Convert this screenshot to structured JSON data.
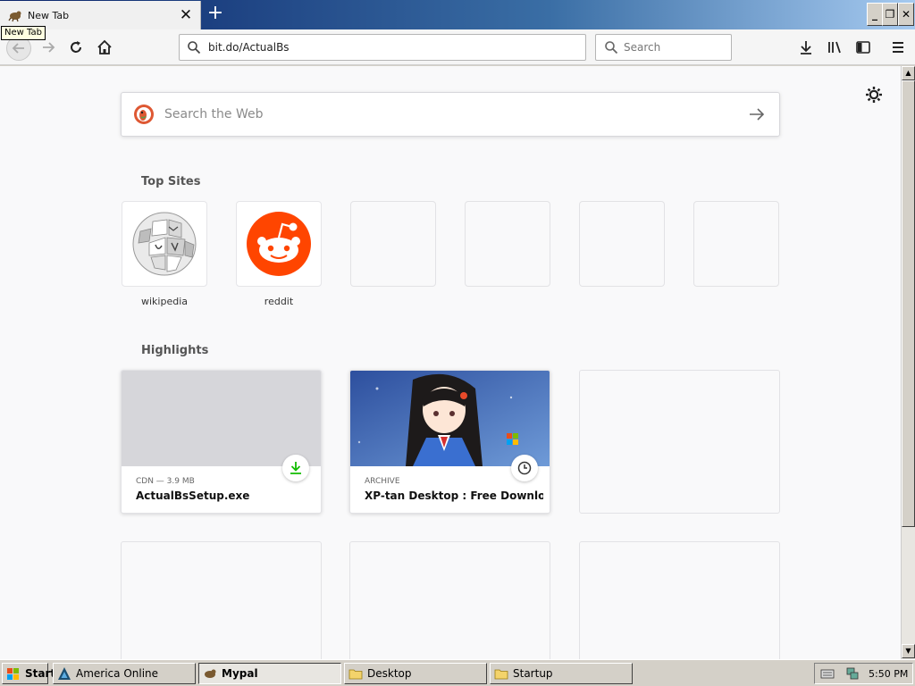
{
  "browser": {
    "tab": {
      "title": "New Tab",
      "close_icon": "close-icon"
    },
    "tooltip": "New Tab",
    "window_controls": [
      "minimize-icon",
      "restore-icon",
      "close-icon"
    ],
    "address_bar": {
      "value": "bit.do/ActualBs"
    },
    "search_bar": {
      "placeholder": "Search"
    },
    "toolbar_icons": [
      "back-icon",
      "forward-icon",
      "reload-icon",
      "home-icon",
      "download-icon",
      "library-icon",
      "sidebar-icon",
      "menu-icon"
    ]
  },
  "newtab": {
    "web_search": {
      "placeholder": "Search the Web"
    },
    "top_sites_title": "Top Sites",
    "top_sites": [
      {
        "label": "wikipedia"
      },
      {
        "label": "reddit"
      },
      {
        "label": ""
      },
      {
        "label": ""
      },
      {
        "label": ""
      },
      {
        "label": ""
      }
    ],
    "highlights_title": "Highlights",
    "highlights": [
      {
        "meta": "CDN — 3.9 MB",
        "title": "ActualBsSetup.exe",
        "badge": "download-icon"
      },
      {
        "meta": "ARCHIVE",
        "title": "XP-tan Desktop : Free Download...",
        "badge": "clock-icon"
      }
    ]
  },
  "taskbar": {
    "start_label": "Start",
    "tasks": [
      {
        "label": "America  Online"
      },
      {
        "label": "Mypal"
      },
      {
        "label": "Desktop"
      },
      {
        "label": "Startup"
      }
    ],
    "clock": "5:50 PM"
  },
  "colors": {
    "accent": "#0060df",
    "reddit": "#ff4500",
    "download_green": "#12bc00",
    "titlebar": "#0a246a"
  }
}
